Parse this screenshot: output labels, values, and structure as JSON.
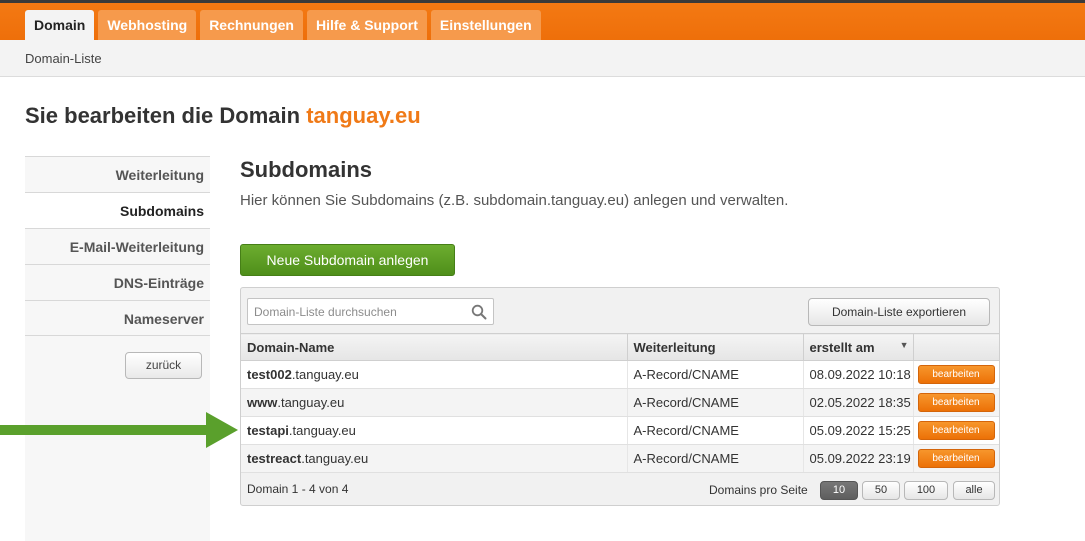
{
  "nav": {
    "tabs": [
      "Domain",
      "Webhosting",
      "Rechnungen",
      "Hilfe & Support",
      "Einstellungen"
    ],
    "active_tab": "Domain"
  },
  "breadcrumb": "Domain-Liste",
  "heading": {
    "prefix": "Sie bearbeiten die Domain",
    "domain": "tanguay.eu"
  },
  "sidebar": {
    "items": [
      "Weiterleitung",
      "Subdomains",
      "E-Mail-Weiterleitung",
      "DNS-Einträge",
      "Nameserver"
    ],
    "active": "Subdomains",
    "back_label": "zurück"
  },
  "section": {
    "title": "Subdomains",
    "description": "Hier können Sie Subdomains (z.B. subdomain.tanguay.eu) anlegen und verwalten.",
    "new_button": "Neue Subdomain anlegen"
  },
  "toolbar": {
    "search_placeholder": "Domain-Liste durchsuchen",
    "export_label": "Domain-Liste exportieren"
  },
  "table": {
    "columns": [
      "Domain-Name",
      "Weiterleitung",
      "erstellt am",
      ""
    ],
    "rows": [
      {
        "sub": "test002",
        "suffix": ".tanguay.eu",
        "forward": "A-Record/CNAME",
        "created": "08.09.2022 10:18",
        "action": "bearbeiten"
      },
      {
        "sub": "www",
        "suffix": ".tanguay.eu",
        "forward": "A-Record/CNAME",
        "created": "02.05.2022 18:35",
        "action": "bearbeiten"
      },
      {
        "sub": "testapi",
        "suffix": ".tanguay.eu",
        "forward": "A-Record/CNAME",
        "created": "05.09.2022 15:25",
        "action": "bearbeiten"
      },
      {
        "sub": "testreact",
        "suffix": ".tanguay.eu",
        "forward": "A-Record/CNAME",
        "created": "05.09.2022 23:19",
        "action": "bearbeiten"
      }
    ]
  },
  "footer": {
    "count": "Domain 1 - 4 von 4",
    "per_page_label": "Domains pro Seite",
    "options": [
      "10",
      "50",
      "100",
      "alle"
    ],
    "selected": "10"
  },
  "colors": {
    "brand_orange": "#f07a17",
    "annotation_arrow": "#5aa02c",
    "primary_green": "#5c9e22"
  },
  "icons": {
    "search": "search-icon",
    "sort": "sort-desc-icon",
    "annotation": "arrow-right-icon"
  }
}
